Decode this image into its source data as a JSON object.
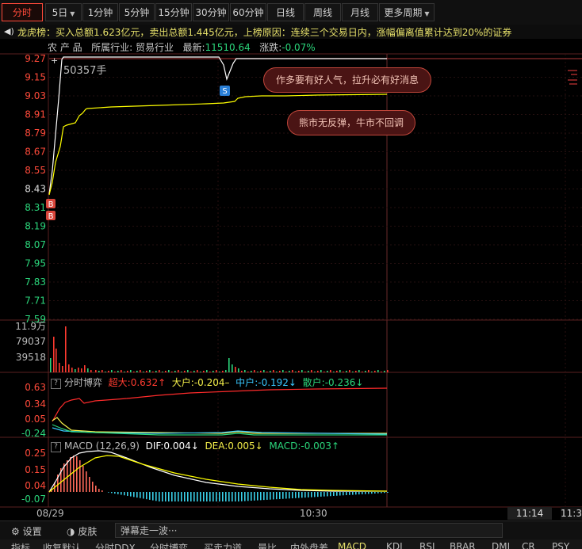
{
  "tabs": [
    {
      "label": "分时",
      "active": true
    },
    {
      "label": "5日",
      "dropdown": true
    },
    {
      "label": "1分钟"
    },
    {
      "label": "5分钟"
    },
    {
      "label": "15分钟"
    },
    {
      "label": "30分钟"
    },
    {
      "label": "60分钟"
    },
    {
      "label": "日线"
    },
    {
      "label": "周线"
    },
    {
      "label": "月线"
    },
    {
      "label": "更多周期",
      "dropdown": true
    }
  ],
  "dragon_tiger": {
    "icon": "speaker-icon",
    "text": "龙虎榜：买入总额1.623亿元，卖出总额1.445亿元，上榜原因：连续三个交易日内，涨幅偏离值累计达到20%的证券"
  },
  "info": {
    "name": "农 产 品",
    "industry_label": "所属行业:",
    "industry": "贸易行业",
    "latest_label": "最新:",
    "latest": "11510.64",
    "change_label": "涨跌:",
    "change": "-0.07%"
  },
  "price_panel": {
    "volume_tooltip": "50357手",
    "y_ticks": [
      "9.27",
      "9.15",
      "9.03",
      "8.91",
      "8.79",
      "8.67",
      "8.55",
      "8.43",
      "8.31",
      "8.19",
      "8.07",
      "7.95",
      "7.83",
      "7.71",
      "7.59"
    ],
    "notes": [
      "作多要有好人气，拉升必有好消息",
      "熊市无反弹，牛市不回调"
    ],
    "markers": {
      "buy": "B",
      "sell": "S"
    }
  },
  "volume_panel": {
    "y_ticks": [
      "11.9万",
      "79037",
      "39518"
    ]
  },
  "game_panel": {
    "title": "分时博弈",
    "labels": [
      {
        "name": "超大",
        "value": "0.632",
        "arrow": "↑",
        "color": "#ff3b30"
      },
      {
        "name": "大户",
        "value": "-0.204",
        "arrow": "–",
        "color": "#f5f04a"
      },
      {
        "name": "中户",
        "value": "-0.192",
        "arrow": "↓",
        "color": "#39c8ff"
      },
      {
        "name": "散户",
        "value": "-0.236",
        "arrow": "↓",
        "color": "#2bd67b"
      }
    ],
    "y_ticks": [
      "0.63",
      "0.34",
      "0.05",
      "-0.24"
    ]
  },
  "macd_panel": {
    "title": "MACD (12,26,9)",
    "dif": "DIF:0.004↓",
    "dea": "DEA:0.005↓",
    "macd": "MACD:-0.003↑",
    "y_ticks": [
      "0.25",
      "0.15",
      "0.04",
      "-0.07"
    ]
  },
  "x_axis": {
    "labels": [
      "08/29",
      "10:30"
    ],
    "current_time": "11:14",
    "right_time": "11:3"
  },
  "settings_bar": {
    "settings": "设置",
    "skin": "皮肤",
    "danmu": "弹幕走一波···"
  },
  "bottom_tabs": [
    "指标",
    "收复默认",
    "分时DDX",
    "分时博弈",
    "买卖力道",
    "量比",
    "内外盘差",
    "MACD",
    "KDJ",
    "RSI",
    "BRAR",
    "DMI",
    "CR",
    "PSY"
  ],
  "colors": {
    "price_line": "#ffffff",
    "avg_line": "#ffff00",
    "up": "#ff3b30",
    "down": "#2bd67b",
    "grid": "#3a1515"
  }
}
